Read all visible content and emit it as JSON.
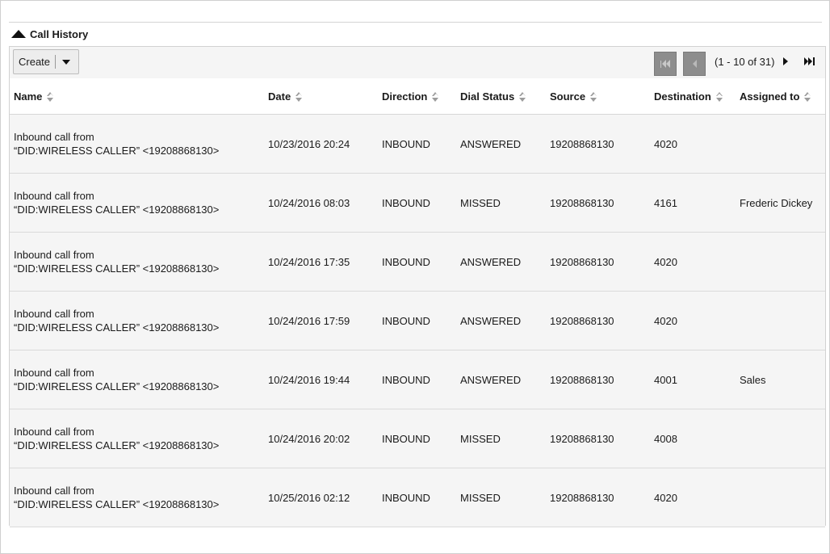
{
  "subpanel": {
    "title": "Call History",
    "collapse_icon": "chevron-up-icon"
  },
  "toolbar": {
    "create_label": "Create",
    "create_menu_icon": "caret-down-icon"
  },
  "pagination": {
    "range_text": "(1 - 10 of 31)",
    "first_icon": "first-page-icon",
    "prev_icon": "prev-page-icon",
    "next_icon": "next-page-icon",
    "last_icon": "last-page-icon"
  },
  "table": {
    "columns": [
      "Name",
      "Date",
      "Direction",
      "Dial Status",
      "Source",
      "Destination",
      "Assigned to"
    ],
    "rows": [
      {
        "name_line1": "Inbound call from",
        "name_line2": "“DID:WIRELESS CALLER” <19208868130>",
        "date": "10/23/2016 20:24",
        "direction": "INBOUND",
        "dial_status": "ANSWERED",
        "source": "19208868130",
        "destination": "4020",
        "assigned_to": ""
      },
      {
        "name_line1": "Inbound call from",
        "name_line2": "“DID:WIRELESS CALLER” <19208868130>",
        "date": "10/24/2016 08:03",
        "direction": "INBOUND",
        "dial_status": "MISSED",
        "source": "19208868130",
        "destination": "4161",
        "assigned_to": "Frederic Dickey"
      },
      {
        "name_line1": "Inbound call from",
        "name_line2": "“DID:WIRELESS CALLER” <19208868130>",
        "date": "10/24/2016 17:35",
        "direction": "INBOUND",
        "dial_status": "ANSWERED",
        "source": "19208868130",
        "destination": "4020",
        "assigned_to": ""
      },
      {
        "name_line1": "Inbound call from",
        "name_line2": "“DID:WIRELESS CALLER” <19208868130>",
        "date": "10/24/2016 17:59",
        "direction": "INBOUND",
        "dial_status": "ANSWERED",
        "source": "19208868130",
        "destination": "4020",
        "assigned_to": ""
      },
      {
        "name_line1": "Inbound call from",
        "name_line2": "“DID:WIRELESS CALLER” <19208868130>",
        "date": "10/24/2016 19:44",
        "direction": "INBOUND",
        "dial_status": "ANSWERED",
        "source": "19208868130",
        "destination": "4001",
        "assigned_to": "Sales"
      },
      {
        "name_line1": "Inbound call from",
        "name_line2": "“DID:WIRELESS CALLER” <19208868130>",
        "date": "10/24/2016 20:02",
        "direction": "INBOUND",
        "dial_status": "MISSED",
        "source": "19208868130",
        "destination": "4008",
        "assigned_to": ""
      },
      {
        "name_line1": "Inbound call from",
        "name_line2": "“DID:WIRELESS CALLER” <19208868130>",
        "date": "10/25/2016 02:12",
        "direction": "INBOUND",
        "dial_status": "MISSED",
        "source": "19208868130",
        "destination": "4020",
        "assigned_to": ""
      }
    ]
  }
}
